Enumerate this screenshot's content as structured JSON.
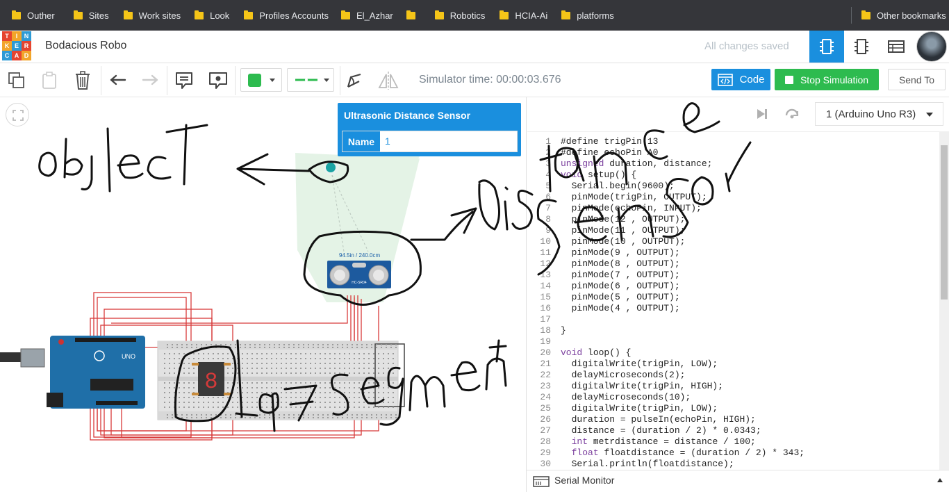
{
  "bookmarks": {
    "items": [
      "Outher",
      "Sites",
      "Work sites",
      "Look",
      "Profiles Accounts",
      "El_Azhar",
      "",
      "Robotics",
      "HCIA-Ai",
      "platforms"
    ],
    "other": "Other bookmarks"
  },
  "app": {
    "logo_letters": [
      "TIN",
      "KER",
      "CAD"
    ],
    "project_name": "Bodacious Robo",
    "save_status": "All changes saved",
    "accent": "#1a8fde"
  },
  "toolbar": {
    "sim_time": "Simulator time: 00:00:03.676",
    "code_label": "Code",
    "stop_label": "Stop Simulation",
    "send_label": "Send To",
    "fill_color": "#2dbb4f",
    "line_color": "#2dbb4f"
  },
  "inspector": {
    "title": "Ultrasonic Distance Sensor",
    "name_label": "Name",
    "name_value": "1"
  },
  "canvas": {
    "sensor_readout": "94.5in / 240.0cm",
    "sensor_model": "HC-SR04",
    "board_label": "UNO",
    "segment_digit": "8",
    "annotations": [
      "object",
      "Distance Sensor",
      "7 segment"
    ]
  },
  "code_panel": {
    "board_select": "1 (Arduino Uno R3)",
    "serial_monitor": "Serial Monitor",
    "lines": [
      "#define trigPin 13",
      "#define echoPin A0",
      "unsigned duration, distance;",
      "void setup() {",
      "  Serial.begin(9600);",
      "  pinMode(trigPin, OUTPUT);",
      "  pinMode(echoPin, INPUT);",
      "  pinMode(12 , OUTPUT);",
      "  pinMode(11 , OUTPUT);",
      "  pinMode(10 , OUTPUT);",
      "  pinMode(9 , OUTPUT);",
      "  pinMode(8 , OUTPUT);",
      "  pinMode(7 , OUTPUT);",
      "  pinMode(6 , OUTPUT);",
      "  pinMode(5 , OUTPUT);",
      "  pinMode(4 , OUTPUT);",
      "",
      "}",
      "",
      "void loop() {",
      "  digitalWrite(trigPin, LOW);",
      "  delayMicroseconds(2);",
      "  digitalWrite(trigPin, HIGH);",
      "  delayMicroseconds(10);",
      "  digitalWrite(trigPin, LOW);",
      "  duration = pulseIn(echoPin, HIGH);",
      "  distance = (duration / 2) * 0.0343;",
      "  int metrdistance = distance / 100;",
      "  float floatdistance = (duration / 2) * 343;",
      "  Serial.println(floatdistance);"
    ]
  }
}
